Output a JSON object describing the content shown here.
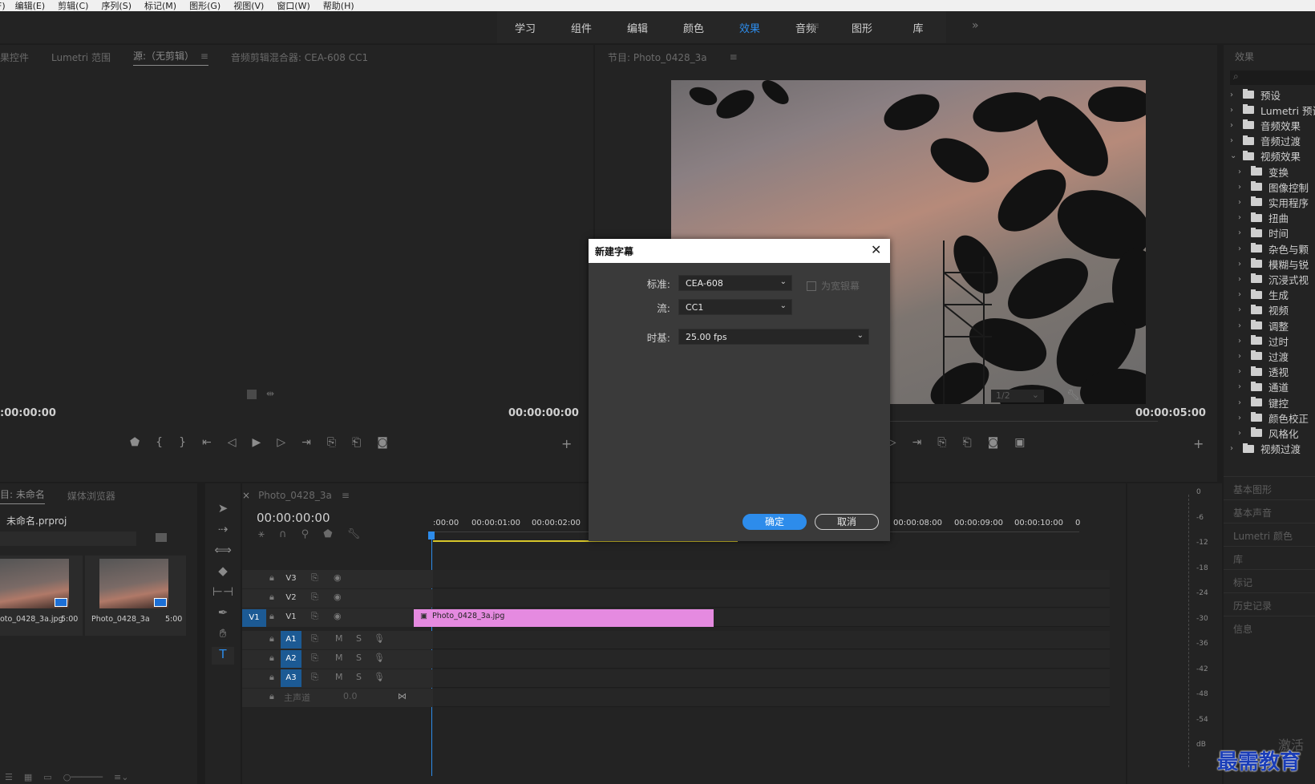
{
  "menu": [
    "F)",
    "编辑(E)",
    "剪辑(C)",
    "序列(S)",
    "标记(M)",
    "图形(G)",
    "视图(V)",
    "窗口(W)",
    "帮助(H)"
  ],
  "workspaces": {
    "tabs": [
      "学习",
      "组件",
      "编辑",
      "颜色",
      "效果",
      "音频",
      "图形",
      "库"
    ],
    "active": "效果",
    "more": "»"
  },
  "source_panel": {
    "tabs": [
      "果控件",
      "Lumetri 范围",
      "源:（无剪辑）",
      "音频剪辑混合器: CEA-608 CC1"
    ],
    "timecode_left": ":00:00:00",
    "timecode_right": "00:00:00:00"
  },
  "program_panel": {
    "tab": "节目: Photo_0428_3a",
    "zoom": "1/2",
    "timecode": "00:00:05:00"
  },
  "effects_panel": {
    "title": "效果",
    "search_placeholder": "⌕",
    "items": [
      {
        "label": "预设",
        "level": 0,
        "expanded": false
      },
      {
        "label": "Lumetri 预设",
        "level": 0,
        "expanded": false
      },
      {
        "label": "音频效果",
        "level": 0,
        "expanded": false
      },
      {
        "label": "音频过渡",
        "level": 0,
        "expanded": false
      },
      {
        "label": "视频效果",
        "level": 0,
        "expanded": true
      },
      {
        "label": "变换",
        "level": 1,
        "expanded": false
      },
      {
        "label": "图像控制",
        "level": 1,
        "expanded": false
      },
      {
        "label": "实用程序",
        "level": 1,
        "expanded": false
      },
      {
        "label": "扭曲",
        "level": 1,
        "expanded": false
      },
      {
        "label": "时间",
        "level": 1,
        "expanded": false
      },
      {
        "label": "杂色与颗",
        "level": 1,
        "expanded": false
      },
      {
        "label": "模糊与锐",
        "level": 1,
        "expanded": false
      },
      {
        "label": "沉浸式视",
        "level": 1,
        "expanded": false
      },
      {
        "label": "生成",
        "level": 1,
        "expanded": false
      },
      {
        "label": "视频",
        "level": 1,
        "expanded": false
      },
      {
        "label": "调整",
        "level": 1,
        "expanded": false
      },
      {
        "label": "过时",
        "level": 1,
        "expanded": false
      },
      {
        "label": "过渡",
        "level": 1,
        "expanded": false
      },
      {
        "label": "透视",
        "level": 1,
        "expanded": false
      },
      {
        "label": "通道",
        "level": 1,
        "expanded": false
      },
      {
        "label": "键控",
        "level": 1,
        "expanded": false
      },
      {
        "label": "颜色校正",
        "level": 1,
        "expanded": false
      },
      {
        "label": "风格化",
        "level": 1,
        "expanded": false
      },
      {
        "label": "视频过渡",
        "level": 0,
        "expanded": false
      }
    ],
    "collapsed_panels": [
      "基本图形",
      "基本声音",
      "Lumetri 颜色",
      "库",
      "标记",
      "历史记录",
      "信息"
    ]
  },
  "project_panel": {
    "tabs": [
      "目: 未命名",
      "媒体浏览器"
    ],
    "project_file": "未命名.prproj",
    "items": [
      {
        "name": "oto_0428_3a.jpg",
        "duration": "5:00"
      },
      {
        "name": "Photo_0428_3a",
        "duration": "5:00"
      }
    ]
  },
  "timeline": {
    "sequence_tab": "Photo_0428_3a",
    "timecode": "00:00:00:00",
    "ruler": [
      ":00:00",
      "00:00:01:00",
      "00:00:02:00",
      "00:00:08:00",
      "00:00:09:00",
      "00:00:10:00",
      "0",
      "0"
    ],
    "video_tracks": [
      "V3",
      "V2",
      "V1"
    ],
    "audio_tracks": [
      "A1",
      "A2",
      "A3"
    ],
    "source_patch": "V1",
    "master": {
      "label": "主声道",
      "value": "0.0"
    },
    "clip": {
      "name": "Photo_0428_3a.jpg",
      "color": "#e58ae0"
    },
    "mute": "M",
    "solo": "S"
  },
  "meter": {
    "labels": [
      "0",
      "-6",
      "-12",
      "-18",
      "-24",
      "-30",
      "-36",
      "-42",
      "-48",
      "-54",
      "dB"
    ]
  },
  "dialog": {
    "title": "新建字幕",
    "standard_label": "标准:",
    "standard_value": "CEA-608",
    "stream_label": "流:",
    "stream_value": "CC1",
    "timebase_label": "时基:",
    "timebase_value": "25.00 fps",
    "widescreen_label": "为宽银幕",
    "ok_label": "确定",
    "cancel_label": "取消"
  },
  "watermark": "最需教育",
  "activate_text": "激活",
  "colors": {
    "accent": "#2d8ceb",
    "clip": "#e58ae0",
    "panel_bg": "#232323",
    "dialog_bg": "#3a3a3a"
  }
}
